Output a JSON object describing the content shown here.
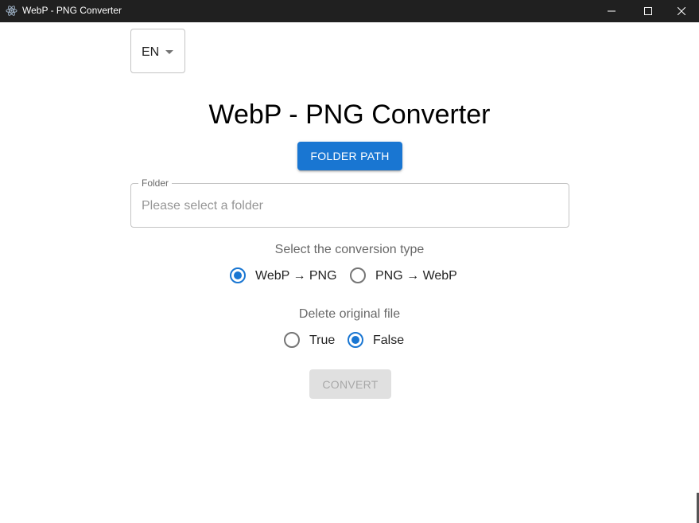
{
  "window": {
    "title": "WebP - PNG Converter",
    "icon": "electron-atom-icon",
    "controls": {
      "minimize": "minimize-icon",
      "maximize": "maximize-icon",
      "close": "close-icon"
    }
  },
  "language": {
    "selected": "EN"
  },
  "heading": "WebP - PNG Converter",
  "folder_button": {
    "label": "FOLDER PATH"
  },
  "folder_field": {
    "label": "Folder",
    "value": "",
    "placeholder": "Please select a folder"
  },
  "conversion": {
    "label": "Select the conversion type",
    "options": [
      {
        "label": "WebP → PNG",
        "checked": true
      },
      {
        "label": "PNG → WebP",
        "checked": false
      }
    ]
  },
  "delete_original": {
    "label": "Delete original file",
    "options": [
      {
        "label": "True",
        "checked": false
      },
      {
        "label": "False",
        "checked": true
      }
    ]
  },
  "convert_button": {
    "label": "CONVERT",
    "disabled": true
  },
  "colors": {
    "primary": "#1976d2",
    "titlebar": "#202020"
  }
}
